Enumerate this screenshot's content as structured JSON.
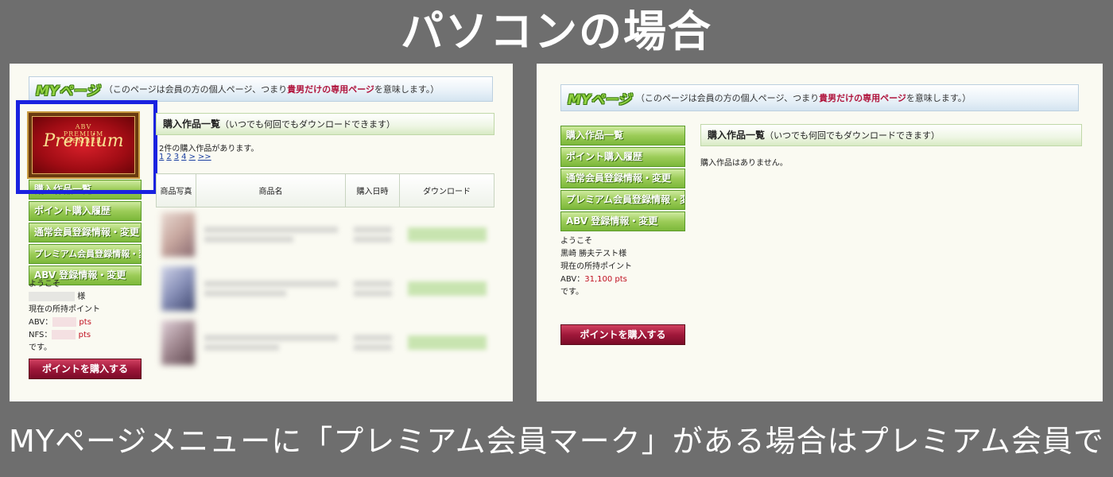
{
  "title": "パソコンの場合",
  "caption": "MYページメニューに「プレミアム会員マーク」がある場合はプレミアム会員です。",
  "colors": {
    "background": "#6e6e6e",
    "highlight": "#1a22e0",
    "menu_green": "#7cb83a",
    "buy_button": "#a0183a",
    "points_red": "#c01020"
  },
  "mypage": {
    "title": "MYページ",
    "desc_pre": "（このページは会員の方の個人ページ、つまり",
    "desc_highlight": "貴男だけの専用ページ",
    "desc_post": "を意味します。）"
  },
  "menu": {
    "items": [
      "購入作品一覧",
      "ポイント購入履歴",
      "通常会員登録情報・変更",
      "プレミアム会員登録情報・変更",
      "ABV 登録情報・変更"
    ]
  },
  "section": {
    "title": "購入作品一覧",
    "note": "（いつでも何回でもダウンロードできます）"
  },
  "left": {
    "logo": {
      "line1": "ABV",
      "line2": "PREMIUM",
      "line3": "MEMBER",
      "script": "Premium"
    },
    "count_text": "2件の購入作品があります。",
    "pager": [
      "1",
      "2",
      "3",
      "4",
      ">",
      ">>"
    ],
    "table_headers": [
      "商品写真",
      "商品名",
      "購入日時",
      "ダウンロード"
    ],
    "welcome": "ようこそ",
    "honorific": "様",
    "points_label": "現在の所持ポイント",
    "abv_label": "ABV：",
    "nfs_label": "NFS：",
    "pts_unit": "pts",
    "desu": "です。"
  },
  "right": {
    "empty_text": "購入作品はありません。",
    "welcome": "ようこそ",
    "user": "黒崎 勝夫テスト様",
    "points_label": "現在の所持ポイント",
    "abv_label": "ABV：",
    "abv_points": "31,100 pts",
    "desu": "です。"
  },
  "buy_button": "ポイントを購入する"
}
